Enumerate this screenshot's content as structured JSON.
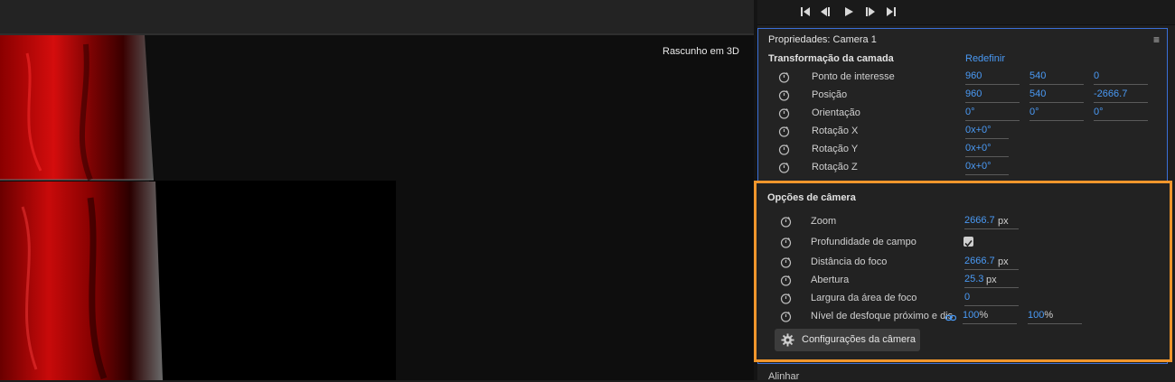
{
  "viewer": {
    "view_label": "Rascunho em 3D"
  },
  "transport": {
    "first_icon": "skip-to-start-icon",
    "prev_icon": "step-back-icon",
    "play_icon": "play-icon",
    "next_icon": "step-forward-icon",
    "last_icon": "skip-to-end-icon"
  },
  "panel": {
    "title": "Propriedades: Camera 1",
    "menu_icon": "≡",
    "layer_transform": {
      "title": "Transformação da camada",
      "reset_label": "Redefinir",
      "rows": [
        {
          "label": "Ponto de interesse",
          "values": [
            "960",
            "540",
            "0"
          ]
        },
        {
          "label": "Posição",
          "values": [
            "960",
            "540",
            "-2666.7"
          ]
        },
        {
          "label": "Orientação",
          "values": [
            "0°",
            "0°",
            "0°"
          ]
        },
        {
          "label": "Rotação X",
          "values": [
            "0x+0°"
          ]
        },
        {
          "label": "Rotação Y",
          "values": [
            "0x+0°"
          ]
        },
        {
          "label": "Rotação Z",
          "values": [
            "0x+0°"
          ]
        }
      ]
    },
    "camera_options": {
      "title": "Opções de câmera",
      "zoom": {
        "label": "Zoom",
        "value": "2666.7",
        "unit": "px"
      },
      "depth_of_field": {
        "label": "Profundidade de campo",
        "checked": true
      },
      "focus_distance": {
        "label": "Distância do foco",
        "value": "2666.7",
        "unit": "px"
      },
      "aperture": {
        "label": "Abertura",
        "value": "25.3",
        "unit": "px"
      },
      "focus_width": {
        "label": "Largura da área de foco",
        "value": "0"
      },
      "blur_level": {
        "label": "Nível de desfoque próximo e dis",
        "value1": "100",
        "value2": "100",
        "unit": "%"
      },
      "settings_button": "Configurações da câmera"
    },
    "align_label": "Alinhar"
  },
  "colors": {
    "accent_blue": "#4a9af5",
    "highlight_orange": "#f0962c",
    "panel_border": "#3a6fd8"
  }
}
